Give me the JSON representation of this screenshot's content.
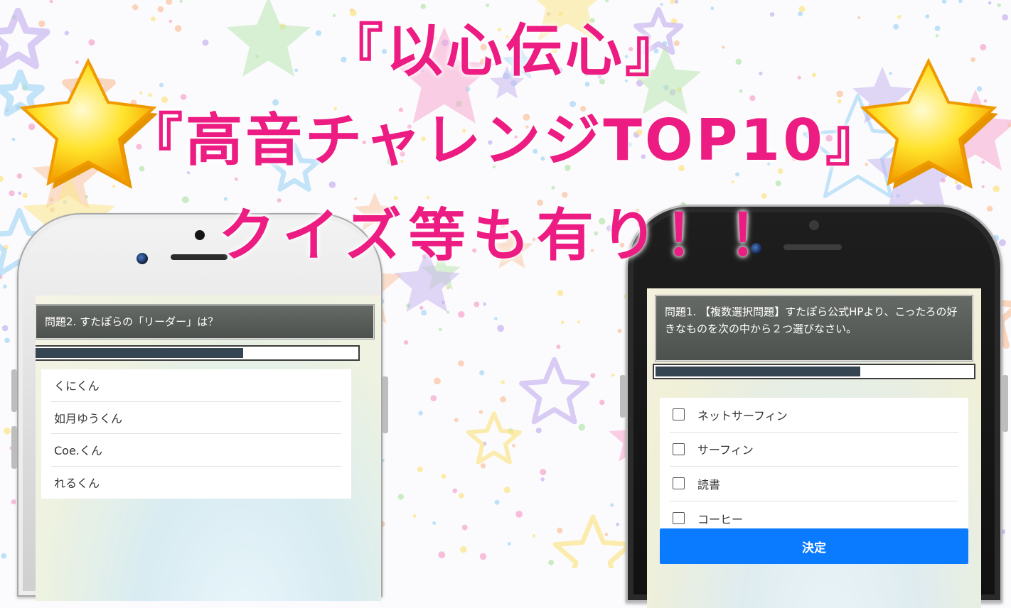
{
  "headline": {
    "line1": "『以心伝心』",
    "line2": "『高音チャレンジTOP10』",
    "line3": "クイズ等も有り！！"
  },
  "colors": {
    "headline": "#ec1c83",
    "progress_fill": "#354551",
    "decide_button": "#0a7bff",
    "question_box": "#555955"
  },
  "phone_left": {
    "question": "問題2. すたぽらの「リーダー」は？",
    "progress_fraction": 0.64,
    "choices": [
      "くにくん",
      "如月ゆうくん",
      "Coe.くん",
      "れるくん"
    ]
  },
  "phone_right": {
    "question": "問題1. 【複数選択問題】すたぽら公式HPより、こったろの好きなものを次の中から２つ選びなさい。",
    "progress_fraction": 0.64,
    "choices": [
      "ネットサーフィン",
      "サーフィン",
      "読書",
      "コーヒー"
    ],
    "submit_label": "決定"
  },
  "icons": [
    "star-icon",
    "camera-icon",
    "speaker-icon",
    "checkbox-icon"
  ]
}
